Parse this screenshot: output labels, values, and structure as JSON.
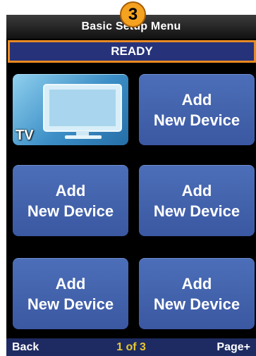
{
  "title": "Basic Setup Menu",
  "step_badge": "3",
  "status": "READY",
  "tiles": [
    {
      "label": "TV",
      "icon": "tv-icon"
    },
    {
      "line1": "Add",
      "line2": "New Device"
    },
    {
      "line1": "Add",
      "line2": "New Device"
    },
    {
      "line1": "Add",
      "line2": "New Device"
    },
    {
      "line1": "Add",
      "line2": "New Device"
    },
    {
      "line1": "Add",
      "line2": "New Device"
    }
  ],
  "bottom": {
    "back": "Back",
    "page": "1 of 3",
    "next": "Page+"
  },
  "colors": {
    "status_border": "#e98a22",
    "status_bg": "#26327a",
    "tile": "#4466b0",
    "page_indicator": "#e6c833",
    "badge": "#f4a21f"
  }
}
